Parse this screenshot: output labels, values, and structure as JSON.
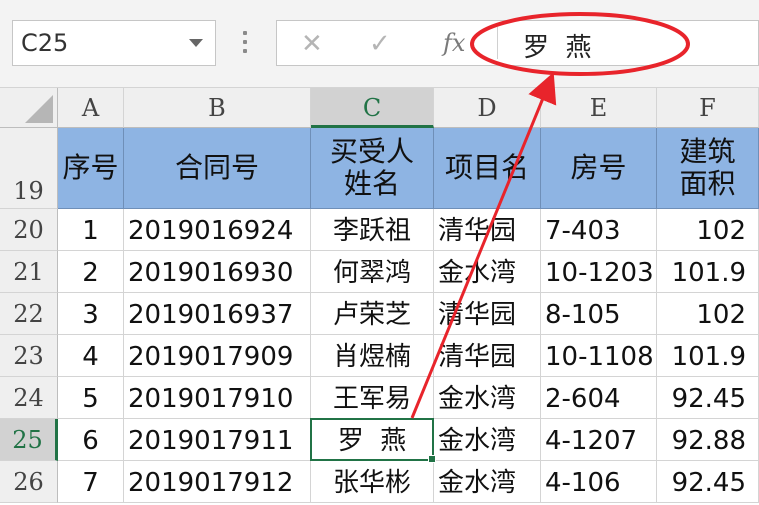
{
  "name_box": {
    "value": "C25"
  },
  "formula_bar": {
    "cancel_icon": "✕",
    "enter_icon": "✓",
    "fx_label": "fx",
    "value": "罗  燕"
  },
  "columns": [
    "A",
    "B",
    "C",
    "D",
    "E",
    "F"
  ],
  "selected_column": "C",
  "header_row": {
    "row_number": "19",
    "cells": [
      "序号",
      "合同号",
      "买受人\n姓名",
      "项目名",
      "房号",
      "建筑\n面积"
    ]
  },
  "rows": [
    {
      "row_number": "20",
      "cells": [
        "1",
        "2019016924",
        "李跃祖",
        "清华园",
        "7-403",
        "102"
      ]
    },
    {
      "row_number": "21",
      "cells": [
        "2",
        "2019016930",
        "何翠鸿",
        "金水湾",
        "10-1203",
        "101.9"
      ]
    },
    {
      "row_number": "22",
      "cells": [
        "3",
        "2019016937",
        "卢荣芝",
        "清华园",
        "8-105",
        "102"
      ]
    },
    {
      "row_number": "23",
      "cells": [
        "4",
        "2019017909",
        "肖煜楠",
        "清华园",
        "10-1108",
        "101.9"
      ]
    },
    {
      "row_number": "24",
      "cells": [
        "5",
        "2019017910",
        "王军易",
        "金水湾",
        "2-604",
        "92.45"
      ]
    },
    {
      "row_number": "25",
      "cells": [
        "6",
        "2019017911",
        "罗  燕",
        "金水湾",
        "4-1207",
        "92.88"
      ]
    },
    {
      "row_number": "26",
      "cells": [
        "7",
        "2019017912",
        "张华彬",
        "金水湾",
        "4-106",
        "92.45"
      ]
    }
  ],
  "selected_row": "25",
  "colors": {
    "header_fill": "#8eb4e3",
    "accent_green": "#217346",
    "annotation_red": "#e8242b"
  }
}
